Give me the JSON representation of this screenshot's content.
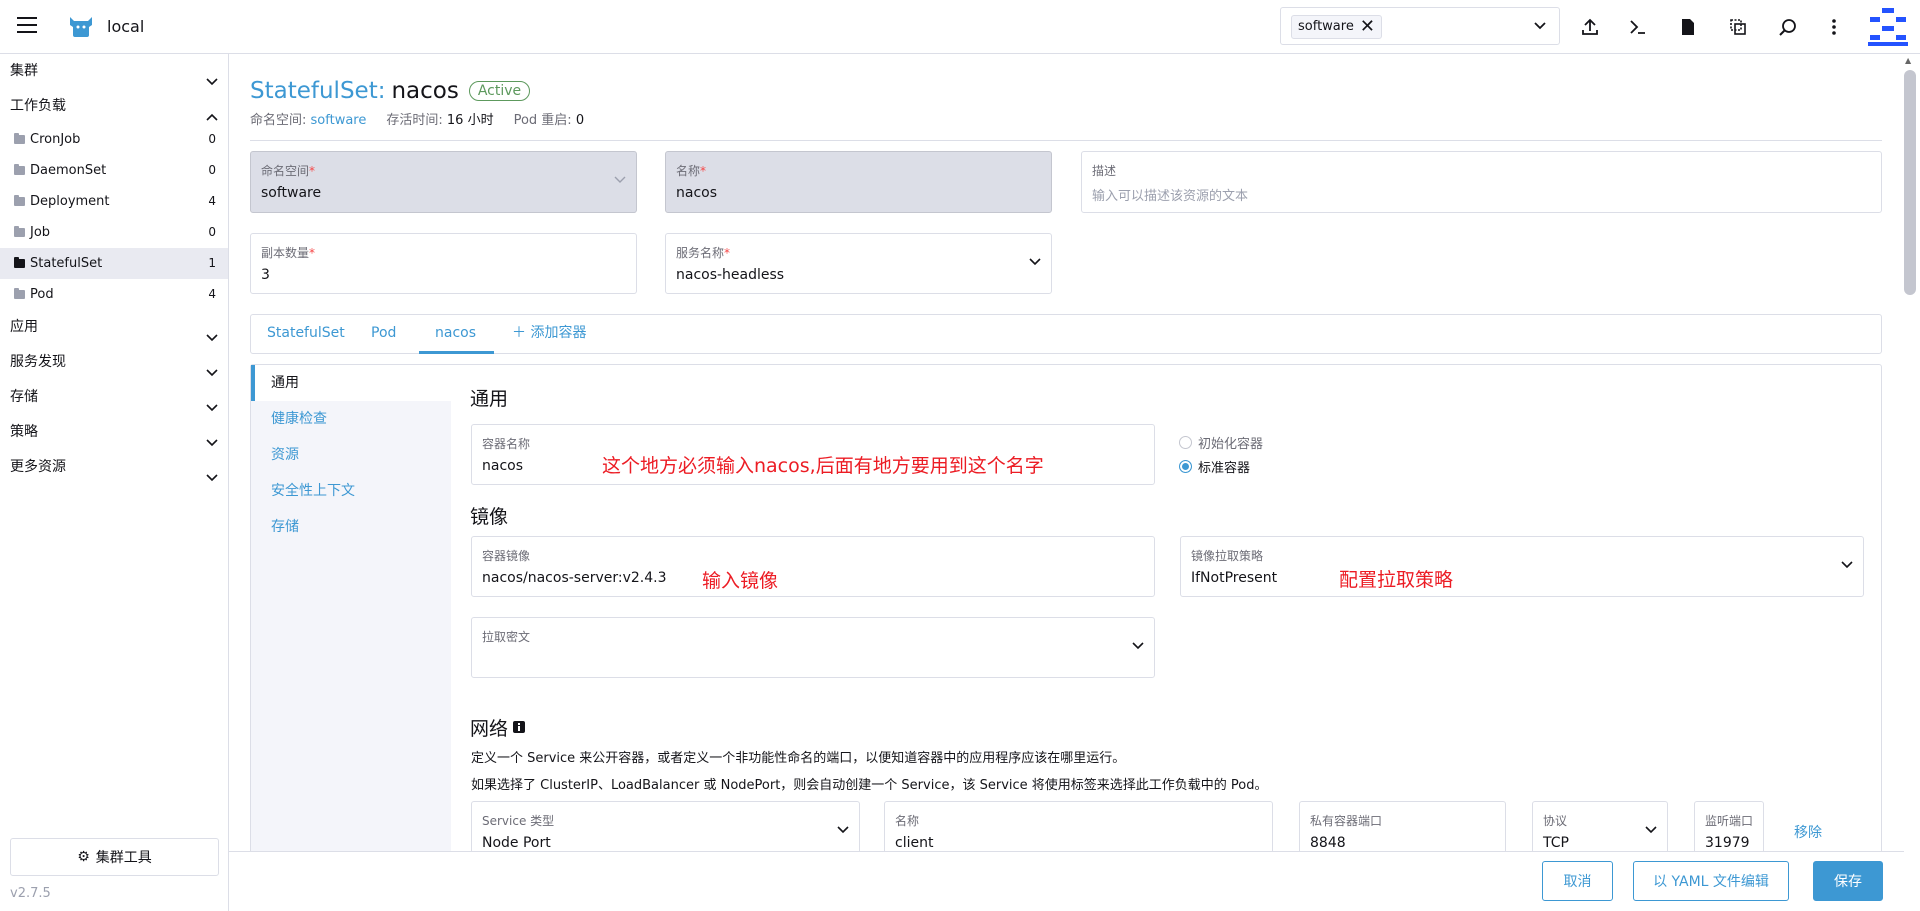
{
  "header": {
    "cluster_name": "local",
    "namespace_chip": "software",
    "icons": [
      "import-yaml-icon",
      "kubectl-shell-icon",
      "kubeconfig-icon",
      "copy-kubeconfig-icon",
      "search-icon",
      "more-icon"
    ]
  },
  "sidebar": {
    "groups": {
      "cluster": "集群",
      "workload": "工作负载",
      "apps": "应用",
      "service_discovery": "服务发现",
      "storage": "存储",
      "policy": "策略",
      "more": "更多资源"
    },
    "workload_items": [
      {
        "label": "CronJob",
        "count": "0"
      },
      {
        "label": "DaemonSet",
        "count": "0"
      },
      {
        "label": "Deployment",
        "count": "4"
      },
      {
        "label": "Job",
        "count": "0"
      },
      {
        "label": "StatefulSet",
        "count": "1"
      },
      {
        "label": "Pod",
        "count": "4"
      }
    ],
    "cluster_tools": "集群工具",
    "version": "v2.7.5"
  },
  "page": {
    "type": "StatefulSet:",
    "name": "nacos",
    "status": "Active",
    "meta": {
      "ns_label": "命名空间:",
      "ns_value": "software",
      "age_label": "存活时间:",
      "age_value": "16 小时",
      "restarts_label": "Pod 重启:",
      "restarts_value": "0"
    }
  },
  "form": {
    "namespace": {
      "label": "命名空间",
      "value": "software"
    },
    "name": {
      "label": "名称",
      "value": "nacos"
    },
    "description": {
      "label": "描述",
      "placeholder": "输入可以描述该资源的文本"
    },
    "replicas": {
      "label": "副本数量",
      "value": "3"
    },
    "service_name": {
      "label": "服务名称",
      "value": "nacos-headless"
    }
  },
  "tabs": [
    "StatefulSet",
    "Pod",
    "nacos",
    "添加容器"
  ],
  "vnav": [
    "通用",
    "健康检查",
    "资源",
    "安全性上下文",
    "存储"
  ],
  "general": {
    "title": "通用",
    "container_name": {
      "label": "容器名称",
      "value": "nacos"
    },
    "radio_init": "初始化容器",
    "radio_standard": "标准容器",
    "note_name": "这个地方必须输入nacos,后面有地方要用到这个名字"
  },
  "image": {
    "title": "镜像",
    "container_image": {
      "label": "容器镜像",
      "value": "nacos/nacos-server:v2.4.3"
    },
    "note_image": "输入镜像",
    "pull_policy": {
      "label": "镜像拉取策略",
      "value": "IfNotPresent"
    },
    "note_policy": "配置拉取策略",
    "pull_secret": {
      "label": "拉取密文"
    }
  },
  "network": {
    "title": "网络",
    "desc1": "定义一个 Service 来公开容器，或者定义一个非功能性命名的端口，以便知道容器中的应用程序应该在哪里运行。",
    "desc2": "如果选择了 ClusterIP、LoadBalancer 或 NodePort，则会自动创建一个 Service，该 Service 将使用标签来选择此工作负载中的 Pod。",
    "port": {
      "service_type": {
        "label": "Service 类型",
        "value": "Node Port"
      },
      "name": {
        "label": "名称",
        "value": "client"
      },
      "container_port": {
        "label": "私有容器端口",
        "value": "8848"
      },
      "protocol": {
        "label": "协议",
        "value": "TCP"
      },
      "listen_port": {
        "label": "监听端口",
        "value": "31979"
      },
      "remove": "移除"
    }
  },
  "footer": {
    "cancel": "取消",
    "edit_yaml": "以 YAML 文件编辑",
    "save": "保存"
  },
  "colors": {
    "accent": "#3d98d3",
    "annotation": "#ec1c24",
    "active_badge": "#5d995d"
  }
}
